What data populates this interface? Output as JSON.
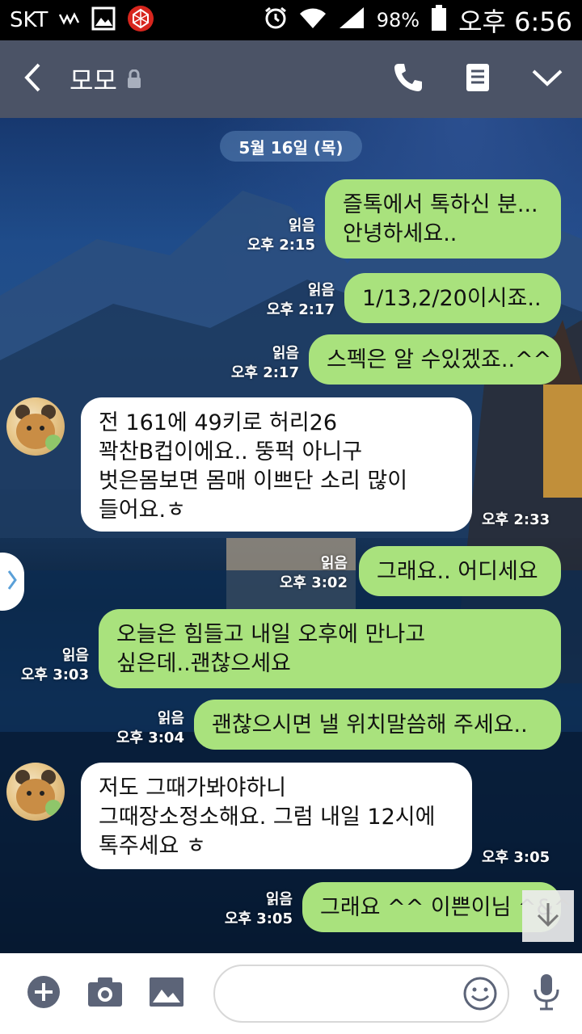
{
  "status_bar": {
    "carrier": "SKT",
    "battery": "98%",
    "time": "오후 6:56"
  },
  "header": {
    "title": "모모",
    "back_icon": "chevron-left-icon",
    "lock_icon": "lock-icon",
    "call_icon": "phone-icon",
    "menu_icon": "document-icon",
    "expand_icon": "chevron-down-icon"
  },
  "chat": {
    "date": "5월 16일 (목)",
    "messages": [
      {
        "from": "me",
        "lines": [
          "즐톡에서 톡하신 분...",
          "안녕하세요.."
        ],
        "read": "읽음",
        "time": "오후 2:15"
      },
      {
        "from": "me",
        "lines": [
          "1/13,2/20이시죠.."
        ],
        "read": "읽음",
        "time": "오후 2:17"
      },
      {
        "from": "me",
        "lines": [
          "스펙은 알 수있겠죠..^^"
        ],
        "read": "읽음",
        "time": "오후 2:17"
      },
      {
        "from": "them",
        "lines": [
          "전 161에 49키로 허리26",
          "꽉찬B컵이에요.. 뚱퍽 아니구",
          "벗은몸보면 몸매 이쁘단 소리 많이",
          "들어요.ㅎ"
        ],
        "time": "오후 2:33"
      },
      {
        "from": "me",
        "lines": [
          "그래요.. 어디세요"
        ],
        "read": "읽음",
        "time": "오후 3:02"
      },
      {
        "from": "me",
        "lines": [
          "오늘은 힘들고 내일 오후에 만나고",
          "싶은데..괜찮으세요"
        ],
        "read": "읽음",
        "time": "오후 3:03"
      },
      {
        "from": "me",
        "lines": [
          "괜찮으시면 낼 위치말씀해 주세요.."
        ],
        "read": "읽음",
        "time": "오후 3:04"
      },
      {
        "from": "them",
        "lines": [
          "저도 그때가봐야하니",
          "그때장소정소해요. 그럼 내일 12시에",
          "톡주세요 ㅎ"
        ],
        "time": "오후 3:05"
      },
      {
        "from": "me",
        "lines": [
          "그래요 ^^ 이쁜이님 ^&^"
        ],
        "read": "읽음",
        "time": "오후 3:05"
      }
    ]
  },
  "input_bar": {
    "placeholder": "",
    "add_icon": "plus-circle-icon",
    "camera_icon": "camera-icon",
    "gallery_icon": "image-icon",
    "emoji_icon": "smiley-icon",
    "mic_icon": "microphone-icon"
  },
  "colors": {
    "header_bg": "#4b5366",
    "my_bubble": "#a9e27d",
    "their_bubble": "#ffffff",
    "status_bg": "#000000"
  }
}
